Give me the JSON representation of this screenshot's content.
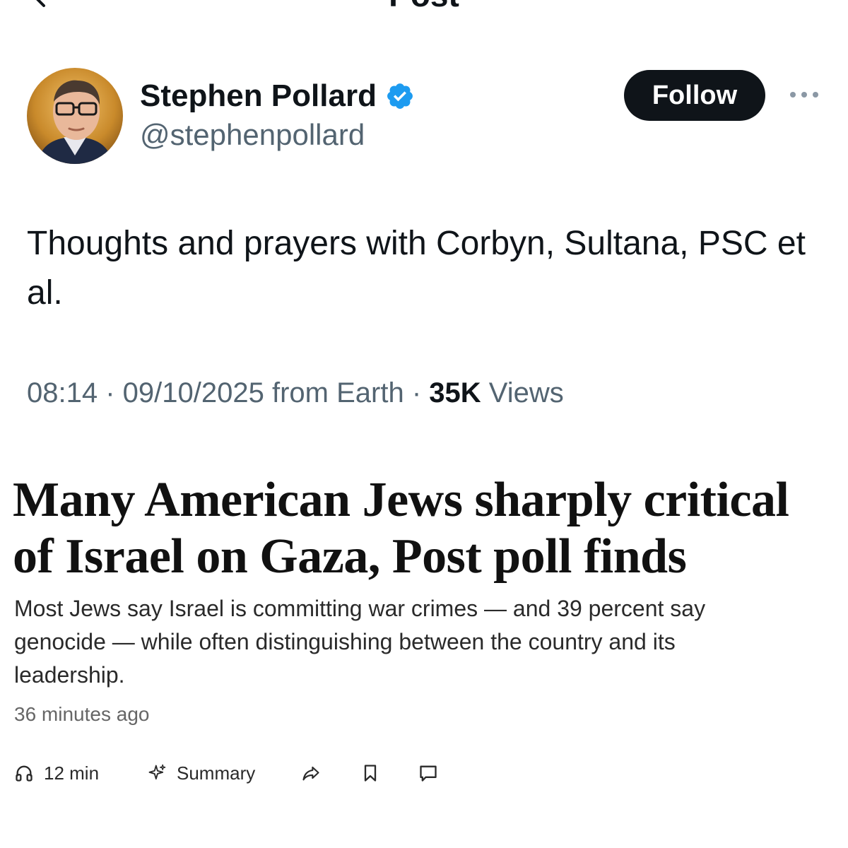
{
  "header": {
    "title": "Post"
  },
  "author": {
    "display_name": "Stephen Pollard",
    "handle": "@stephenpollard",
    "verified": true,
    "avatar_icon": "avatar-photo"
  },
  "follow_button": {
    "label": "Follow"
  },
  "post": {
    "text": "Thoughts and prayers with Corbyn, Sultana, PSC et al.",
    "time": "08:14",
    "date": "09/10/2025",
    "source": "from Earth",
    "views_count": "35K",
    "views_label": "Views"
  },
  "article": {
    "headline": "Many American Jews sharply critical of Israel on Gaza, Post poll finds",
    "deck": "Most Jews say Israel is committing war crimes — and 39 percent say genocide — while often distinguishing between the country and its leadership.",
    "timestamp": "36 minutes ago",
    "actions": [
      {
        "icon": "headphones-icon",
        "label": "12 min"
      },
      {
        "icon": "sparkle-icon",
        "label": "Summary"
      },
      {
        "icon": "share-icon",
        "label": ""
      },
      {
        "icon": "bookmark-icon",
        "label": ""
      },
      {
        "icon": "comment-icon",
        "label": ""
      }
    ]
  },
  "colors": {
    "verified_blue": "#1d9bf0",
    "text_primary": "#0f1419",
    "text_secondary": "#536471",
    "follow_bg": "#0f1419"
  }
}
